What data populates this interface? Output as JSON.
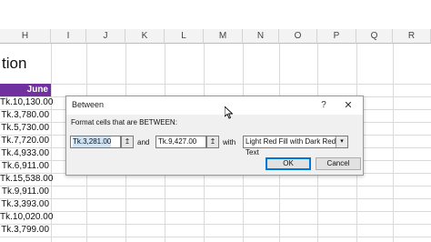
{
  "columns": [
    "H",
    "I",
    "J",
    "K",
    "L",
    "M",
    "N",
    "O",
    "P",
    "Q",
    "R"
  ],
  "title_partial": "tion",
  "june_header": "June",
  "values": [
    "Tk.10,130.00",
    "Tk.3,780.00",
    "Tk.5,730.00",
    "Tk.7,720.00",
    "Tk.4,933.00",
    "Tk.6,911.00",
    "Tk.15,538.00",
    "Tk.9,911.00",
    "Tk.3,393.00",
    "Tk.10,020.00",
    "Tk.3,799.00"
  ],
  "dialog": {
    "title": "Between",
    "help": "?",
    "close": "✕",
    "prompt": "Format cells that are BETWEEN:",
    "from_value": "Tk.3,281.00",
    "and_label": "and",
    "to_value": "Tk.9,427.00",
    "with_label": "with",
    "format_option": "Light Red Fill with Dark Red Text",
    "ok": "OK",
    "cancel": "Cancel",
    "ref_icon": "↥",
    "dropdown_icon": "▾"
  }
}
